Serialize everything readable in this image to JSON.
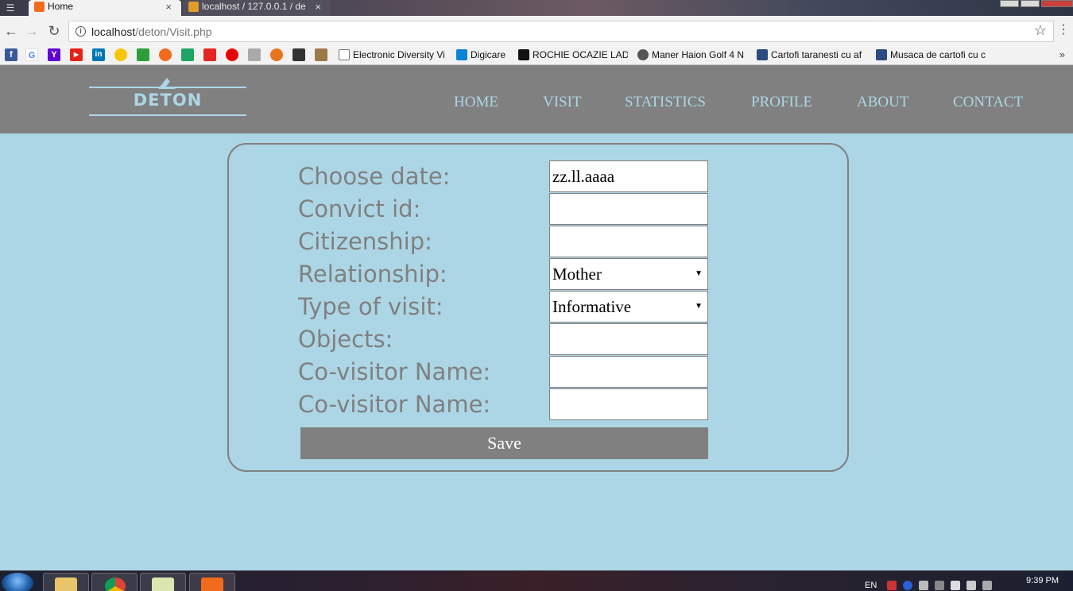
{
  "browser": {
    "tabs": [
      {
        "label": "Home",
        "active": true
      },
      {
        "label": "localhost / 127.0.0.1 / de",
        "active": false
      }
    ],
    "tab_close_glyph": "×",
    "url_host": "localhost",
    "url_path": "/deton/Visit.php",
    "bookmarks": [
      {
        "label": "Electronic Diversity Vi"
      },
      {
        "label": "Digicare"
      },
      {
        "label": "ROCHIE OCAZIE LADY"
      },
      {
        "label": "Maner Haion Golf 4 N"
      },
      {
        "label": "Cartofi taranesti cu af"
      },
      {
        "label": "Musaca de cartofi cu c"
      }
    ],
    "bookmark_icon_letters": [
      "f",
      "G",
      "Y",
      "▶",
      "in"
    ],
    "more_glyph": "»"
  },
  "site": {
    "logo_text": "DETON",
    "nav": [
      "HOME",
      "VISIT",
      "STATISTICS",
      "PROFILE",
      "ABOUT",
      "CONTACT"
    ]
  },
  "form": {
    "fields": [
      {
        "label": "Choose date:",
        "value": "zz.ll.aaaa",
        "type": "date"
      },
      {
        "label": "Convict id:",
        "value": "",
        "type": "text"
      },
      {
        "label": "Citizenship:",
        "value": "",
        "type": "text"
      },
      {
        "label": "Relationship:",
        "value": "Mother",
        "type": "select"
      },
      {
        "label": "Type of visit:",
        "value": "Informative",
        "type": "select"
      },
      {
        "label": "Objects:",
        "value": "",
        "type": "text"
      },
      {
        "label": "Co-visitor Name:",
        "value": "",
        "type": "text"
      },
      {
        "label": "Co-visitor Name:",
        "value": "",
        "type": "text"
      }
    ],
    "save_label": "Save",
    "select_arrow": "▼"
  },
  "taskbar": {
    "language": "EN",
    "clock": "9:39 PM"
  },
  "colors": {
    "page_bg": "#acd6e5",
    "header_bg": "#808080",
    "accent": "#acd6e5",
    "label_gray": "#808080"
  },
  "icons": {
    "back": "back-arrow-icon",
    "forward": "forward-arrow-icon",
    "reload": "reload-icon",
    "bookmark_star": "star-icon",
    "menu": "kebab-menu-icon"
  }
}
